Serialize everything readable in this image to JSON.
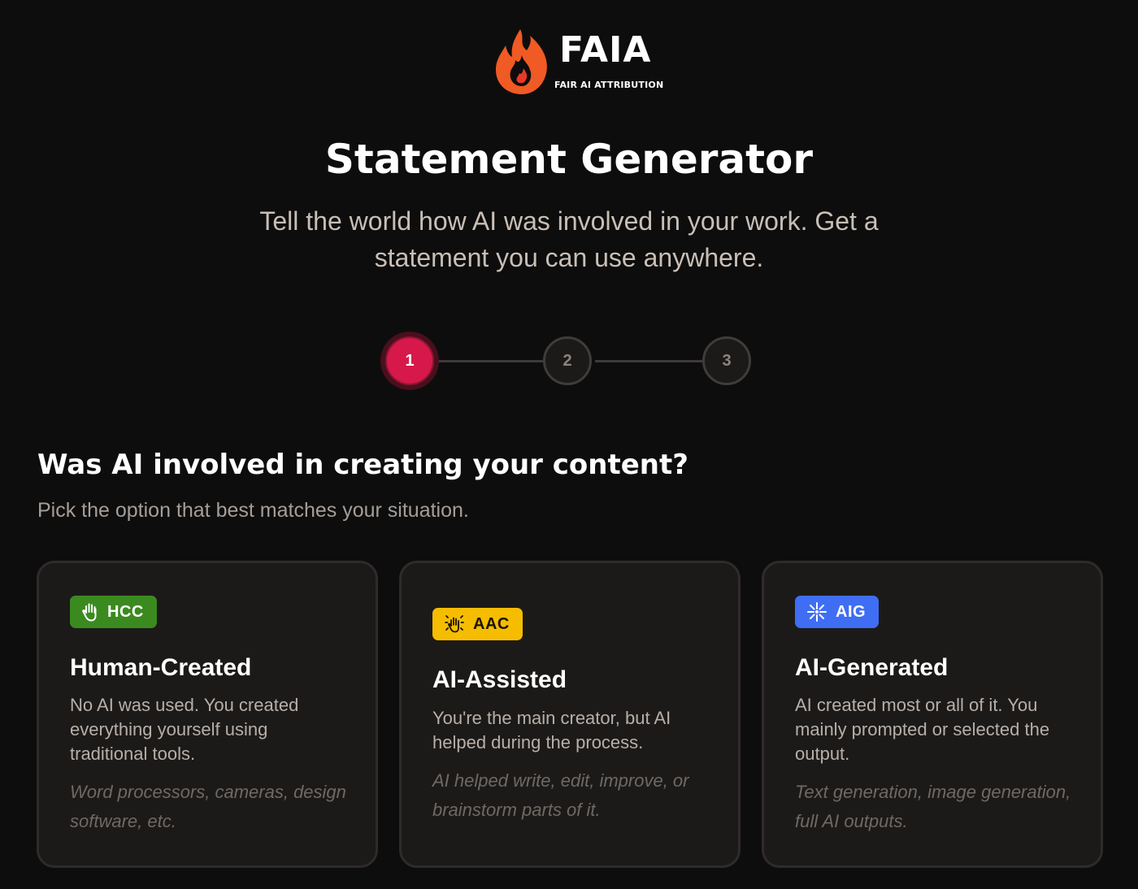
{
  "logo": {
    "wordmark": "FAIA",
    "tagline": "FAIR AI ATTRIBUTION",
    "icon": "flame-icon"
  },
  "header": {
    "title": "Statement Generator",
    "subtitle": "Tell the world how AI was involved in your work. Get a statement you can use anywhere."
  },
  "stepper": {
    "steps": [
      {
        "label": "1",
        "state": "active"
      },
      {
        "label": "2",
        "state": "inactive"
      },
      {
        "label": "3",
        "state": "inactive"
      }
    ],
    "active_color": "#d6184b"
  },
  "question": {
    "heading": "Was AI involved in creating your content?",
    "hint": "Pick the option that best matches your situation."
  },
  "options": [
    {
      "badge": "HCC",
      "badge_icon": "hand-icon",
      "badge_color": "#3b8a1f",
      "title": "Human-Created",
      "description": "No AI was used. You created everything yourself using traditional tools.",
      "examples": "Word processors, cameras, design software, etc."
    },
    {
      "badge": "AAC",
      "badge_icon": "hand-sparkle-icon",
      "badge_color": "#f6bd00",
      "title": "AI-Assisted",
      "description": "You're the main creator, but AI helped during the process.",
      "examples": "AI helped write, edit, improve, or brainstorm parts of it."
    },
    {
      "badge": "AIG",
      "badge_icon": "sparkle-icon",
      "badge_color": "#3f6ef5",
      "title": "AI-Generated",
      "description": "AI created most or all of it. You mainly prompted or selected the output.",
      "examples": "Text generation, image generation, full AI outputs."
    }
  ]
}
